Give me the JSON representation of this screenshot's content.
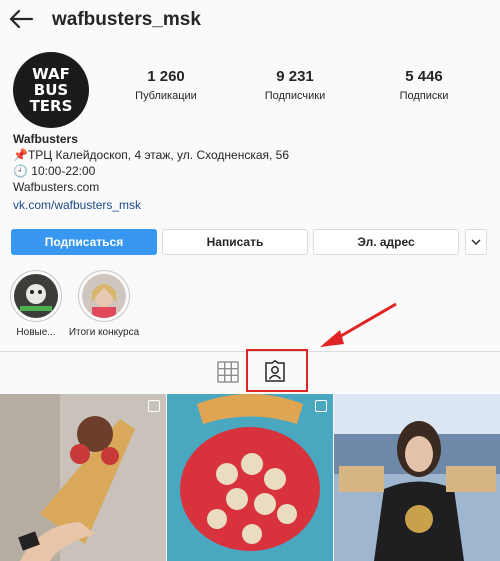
{
  "header": {
    "username": "wafbusters_msk",
    "back_icon": "arrow-left-icon"
  },
  "profile": {
    "avatar_text": [
      "WAF",
      "BUS",
      "TERS"
    ],
    "stats": [
      {
        "value": "1 260",
        "label": "Публикации"
      },
      {
        "value": "9 231",
        "label": "Подписчики"
      },
      {
        "value": "5 446",
        "label": "Подписки"
      }
    ]
  },
  "bio": {
    "name": "Wafbusters",
    "address": "ТРЦ Калейдоскоп, 4 этаж, ул. Сходненская, 56",
    "hours": "10:00-22:00",
    "website": "Wafbusters.com",
    "link": "vk.com/wafbusters_msk"
  },
  "actions": {
    "follow": "Подписаться",
    "message": "Написать",
    "email": "Эл. адрес"
  },
  "highlights": [
    {
      "label": "Новые..."
    },
    {
      "label": "Итоги конкурса"
    }
  ],
  "tabs": {
    "grid_icon": "grid-icon",
    "tagged_icon": "tagged-person-icon"
  },
  "colors": {
    "primary": "#3897f0",
    "annotation": "#e02424"
  }
}
